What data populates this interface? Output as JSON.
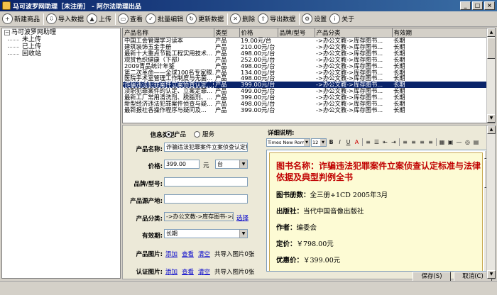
{
  "window": {
    "title": "马可波罗网助理［未注册］ - 阿尔法助理出品",
    "minimize": "_",
    "maximize": "□",
    "close": "×"
  },
  "toolbar": {
    "new_product": "新建商品",
    "import_data": "导入数据",
    "upload": "上传",
    "view": "查看",
    "batch_edit": "批量编辑",
    "update_data": "更新数据",
    "delete": "删除",
    "export_data": "导出数据",
    "settings": "设置",
    "about": "关于"
  },
  "tree": {
    "root": "马可波罗网助理",
    "children": [
      "未上传",
      "已上传",
      "回收站"
    ]
  },
  "grid": {
    "columns": [
      "产品名称",
      "类型",
      "价格",
      "品牌/型号",
      "产品分类",
      "有效期"
    ],
    "rows": [
      [
        "中国工会管理学习读本",
        "产品",
        "19.00元/台",
        "",
        "->办公文教->库存图书...",
        "长期"
      ],
      [
        "建筑装饰五金手册",
        "产品",
        "210.00元/台",
        "",
        "->办公文教->库存图书...",
        "长期"
      ],
      [
        "最新十大重点节能工程实用技术...",
        "产品",
        "498.00元/台",
        "",
        "->办公文教->库存图书...",
        "长期"
      ],
      [
        "观赏色织健康（下部）",
        "产品",
        "252.00元/台",
        "",
        "->办公文教->库存图书...",
        "长期"
      ],
      [
        "2009青品统计年鉴",
        "产品",
        "498.00元/台",
        "",
        "->办公文教->库存图书...",
        "长期"
      ],
      [
        "第二次革命——全球100名专家眼...",
        "产品",
        "134.00元/台",
        "",
        "->办公文教->库存图书...",
        "长期"
      ],
      [
        "医院手术室管理工作制度与无菌...",
        "产品",
        "498.00元/台",
        "",
        "->办公文教->库存图书...",
        "长期"
      ],
      [
        "诈骗违法犯罪案件立案侦查认定...",
        "产品",
        "399.00元/台",
        "",
        "->办公文教->库存图书...",
        "长期"
      ],
      [
        "渎职犯罪案件的认定、立案定罪...",
        "产品",
        "499.00元/台",
        "",
        "->办公文教->库存图书...",
        "长期"
      ],
      [
        "最新工厂常用清洗剂、脱脂剂、...",
        "产品",
        "399.00元/台",
        "",
        "->办公文教->库存图书...",
        "长期"
      ],
      [
        "新型经济违法犯罪案件侦查与疑...",
        "产品",
        "498.00元/台",
        "",
        "->办公文教->库存图书...",
        "长期"
      ],
      [
        "最新报社各操作程序与疑问及...",
        "产品",
        "399.00元/台",
        "",
        "->办公文教->库存图书...",
        "长期"
      ]
    ],
    "selected_index": 7
  },
  "form": {
    "info_type_label": "信息类型:",
    "info_type_product": "产品",
    "info_type_service": "服务",
    "name_label": "产品名称:",
    "name_value": "诈骗违法犯罪案件立案侦查认定标准",
    "price_label": "价格:",
    "price_value": "399.00",
    "price_unit": "元",
    "price_per": "台",
    "brand_label": "品牌/型号:",
    "brand_value": "",
    "origin_label": "产品源产地:",
    "origin_value": "",
    "category_label": "产品分类:",
    "category_value": "->办公文教->库存图书->库存",
    "category_choose": "选择",
    "validity_label": "有效期:",
    "validity_value": "长期",
    "images_label": "产品图片:",
    "cert_label": "认证图片:",
    "add": "添加",
    "view": "查看",
    "clear": "清空",
    "images_count": "共导入图片0张",
    "cert_count": "共导入图片0张"
  },
  "editor": {
    "label": "详细说明:",
    "font_name": "Times New Rom",
    "font_size": "12",
    "title": "图书名称：诈骗违法犯罪案件立案侦查认定标准与法律依据及典型判例全书",
    "lines": [
      {
        "k": "图书册数：",
        "v": "全三册+1CD 2005年3月"
      },
      {
        "k": "出版社：",
        "v": "当代中国音像出版社"
      },
      {
        "k": "作者：",
        "v": "编委会"
      },
      {
        "k": "定价：",
        "v": "￥798.00元"
      },
      {
        "k": "优惠价：",
        "v": "￥399.00元"
      }
    ]
  },
  "buttons": {
    "save": "保存(S)",
    "cancel": "取消(C)"
  }
}
